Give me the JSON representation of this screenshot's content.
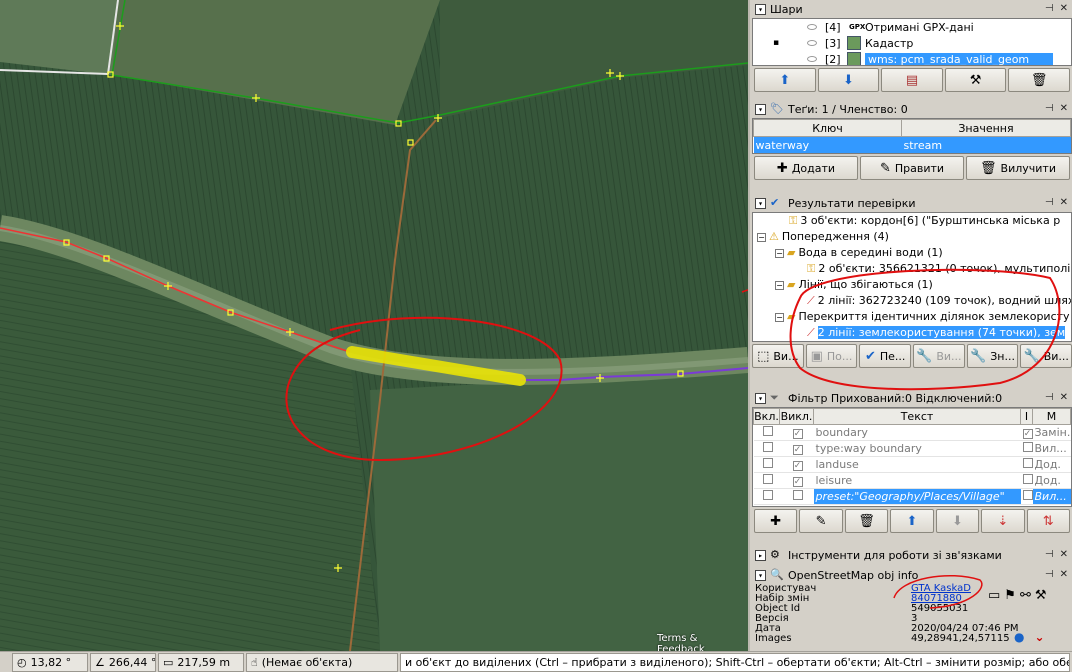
{
  "map": {
    "attribution": "Terms & Feedback"
  },
  "layers": {
    "title": "Шари",
    "items": [
      {
        "index": "[4]",
        "badge": "GPX",
        "name": "Отримані GPX-дані"
      },
      {
        "index": "[3]",
        "name": "Кадастр"
      },
      {
        "index": "[2]",
        "name": "wms: pcm_srada_valid_geom"
      }
    ]
  },
  "tags": {
    "title": "Теґи: 1 / Членство: 0",
    "col_key": "Ключ",
    "col_value": "Значення",
    "rows": [
      {
        "key": "waterway",
        "value": "stream"
      }
    ],
    "add": "Додати",
    "edit": "Правити",
    "delete": "Вилучити"
  },
  "validation": {
    "title": "Результати перевірки",
    "items": [
      "3 об'єкти: кордон[6] (\"Бурштинська міська р",
      "Попередження (4)",
      "Вода в середині води (1)",
      "2 об'єкти: 356621321 (0 точок), мультиполіг",
      "Лінії, що збігаються (1)",
      "2 лінії: 362723240 (109 точок), водний шлях",
      "Перекриття ідентичних ділянок землекористу",
      "2 лінії: землекористування (74 точки), зем"
    ],
    "buttons": [
      "Ви...",
      "По...",
      "Пе...",
      "Ви...",
      "Зн...",
      "Ви..."
    ]
  },
  "filter": {
    "title": "Фільтр Прихований:0 Відключений:0",
    "col_on": "Вкл.",
    "col_off": "Викл.",
    "col_text": "Текст",
    "col_i": "I",
    "col_m": "M",
    "rows": [
      {
        "text": "boundary",
        "mode": "Замін."
      },
      {
        "text": "type:way boundary",
        "mode": "Вил..."
      },
      {
        "text": "landuse",
        "mode": "Дод."
      },
      {
        "text": "leisure",
        "mode": "Дод."
      },
      {
        "text": "preset:\"Geography/Places/Village\"",
        "mode": "Вил..."
      }
    ]
  },
  "relations": {
    "title": "Інструменти для роботи зі зв'язками"
  },
  "osminfo": {
    "title": "OpenStreetMap obj info",
    "labels": [
      "Користувач",
      "Набір змін",
      "Object Id",
      "Версія",
      "Дата",
      "Images"
    ],
    "user": "GTA KaskaD",
    "changeset": "84071880",
    "object_id": "549055031",
    "version": "3",
    "date": "2020/04/24 07:46 PM",
    "coords": "49,28941,24,57115"
  },
  "status": {
    "angle": "13,82 °",
    "heading": "266,44 °",
    "distance": "217,59 m",
    "object": "(Немає об'єкта)",
    "help": "и об'єкт до виділених (Ctrl – прибрати з виділеного); Shift-Ctrl – обертати об'єкти; Alt-Ctrl – змінити розмір; або оберіть інший об'єкт"
  }
}
